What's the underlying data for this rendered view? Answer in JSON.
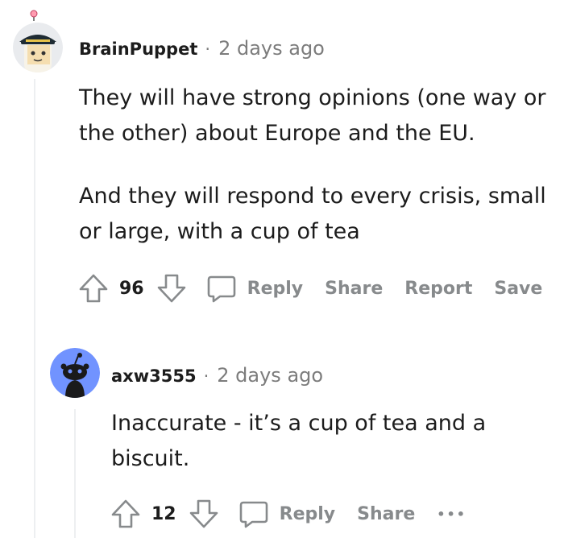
{
  "comments": [
    {
      "username": "BrainPuppet",
      "separator": "·",
      "time": "2 days ago",
      "paragraphs": [
        [
          "They will have strong opinions (one way or",
          "the other) about Europe and the EU."
        ],
        [
          "And they will respond to every crisis, small",
          "or large, with a cup of tea"
        ]
      ],
      "votes": "96",
      "actions": {
        "reply": "Reply",
        "share": "Share",
        "report": "Report",
        "save": "Save"
      }
    },
    {
      "username": "axw3555",
      "separator": "·",
      "time": "2 days ago",
      "paragraphs": [
        [
          "Inaccurate - it’s a cup of tea and a",
          "biscuit."
        ]
      ],
      "votes": "12",
      "actions": {
        "reply": "Reply",
        "share": "Share",
        "more": "•••"
      }
    }
  ],
  "colors": {
    "meta": "#7c7c7c",
    "action": "#878a8c",
    "thread_line": "#edeff1",
    "snoo_bg": "#7193ff"
  },
  "icons": [
    "upvote-icon",
    "downvote-icon",
    "comment-bubble-icon",
    "more-options-icon",
    "user-avatar",
    "snoo-avatar"
  ]
}
